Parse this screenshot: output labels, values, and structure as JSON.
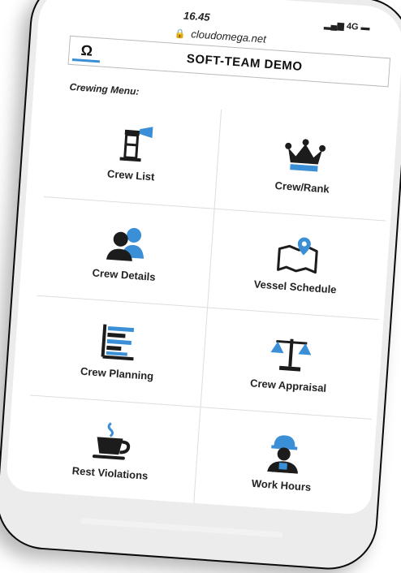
{
  "status": {
    "time": "16.45",
    "signal": "4G"
  },
  "browser": {
    "url": "cloudomega.net"
  },
  "header": {
    "logo_symbol": "Ω",
    "title": "SOFT-TEAM DEMO"
  },
  "menu": {
    "label": "Crewing Menu:",
    "items": [
      {
        "label": "Crew List",
        "icon": "lighthouse-icon"
      },
      {
        "label": "Crew/Rank",
        "icon": "crown-icon"
      },
      {
        "label": "Crew Details",
        "icon": "users-icon"
      },
      {
        "label": "Vessel Schedule",
        "icon": "map-pin-icon"
      },
      {
        "label": "Crew Planning",
        "icon": "gantt-chart-icon"
      },
      {
        "label": "Crew Appraisal",
        "icon": "scales-icon"
      },
      {
        "label": "Rest Violations",
        "icon": "coffee-cup-icon"
      },
      {
        "label": "Work Hours",
        "icon": "worker-icon"
      }
    ]
  },
  "colors": {
    "accent": "#3a8fd6",
    "icon_dark": "#1c1c1c",
    "background": "#ffffff"
  }
}
